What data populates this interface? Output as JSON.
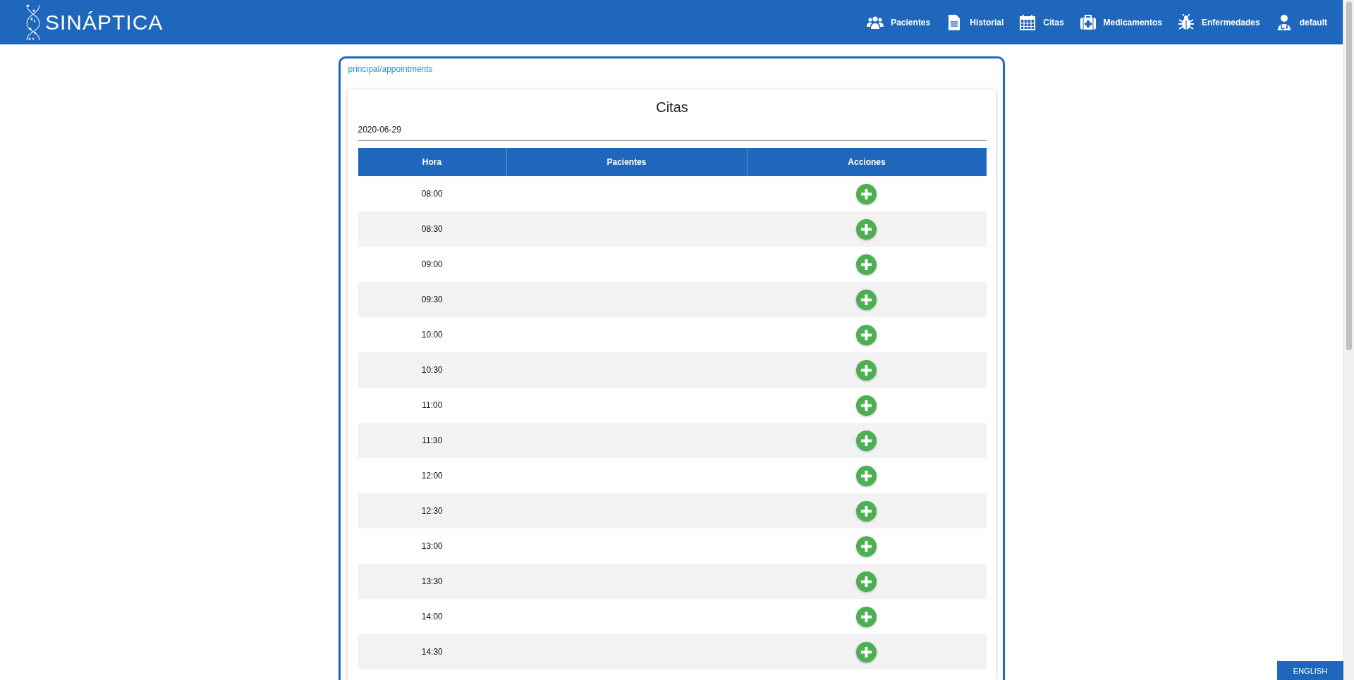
{
  "header": {
    "brand": "SINÁPTICA",
    "nav": [
      {
        "label": "Pacientes"
      },
      {
        "label": "Historial"
      },
      {
        "label": "Citas"
      },
      {
        "label": "Medicamentos"
      },
      {
        "label": "Enfermedades"
      },
      {
        "label": "default"
      }
    ]
  },
  "breadcrumb": "principal/appointments",
  "card": {
    "title": "Citas",
    "date": "2020-06-29",
    "table": {
      "columns": [
        "Hora",
        "Pacientes",
        "Acciones"
      ],
      "rows": [
        {
          "hora": "08:00"
        },
        {
          "hora": "08:30"
        },
        {
          "hora": "09:00"
        },
        {
          "hora": "09:30"
        },
        {
          "hora": "10:00"
        },
        {
          "hora": "10:30"
        },
        {
          "hora": "11:00"
        },
        {
          "hora": "11:30"
        },
        {
          "hora": "12:00"
        },
        {
          "hora": "12:30"
        },
        {
          "hora": "13:00"
        },
        {
          "hora": "13:30"
        },
        {
          "hora": "14:00"
        },
        {
          "hora": "14:30"
        }
      ]
    }
  },
  "language_button": "ENGLISH"
}
